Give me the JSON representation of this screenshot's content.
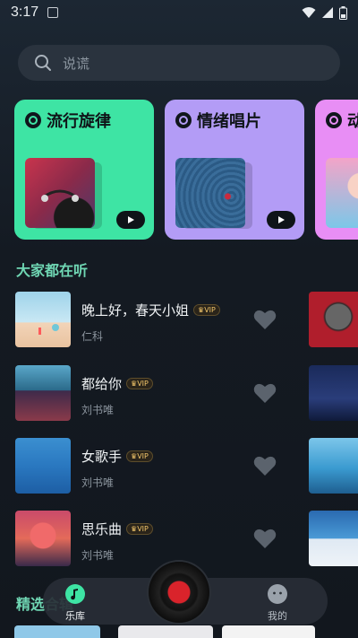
{
  "status_bar": {
    "time": "3:17"
  },
  "search": {
    "placeholder": "说谎"
  },
  "categories": [
    {
      "label": "流行旋律",
      "bg": "#3ee4a4"
    },
    {
      "label": "情绪唱片",
      "bg": "#b39cf6"
    },
    {
      "label": "动",
      "bg": "#e88ef5"
    }
  ],
  "section_popular": "大家都在听",
  "songs": [
    {
      "title": "晚上好，春天小姐",
      "artist": "仁科",
      "vip": "VIP"
    },
    {
      "title": "都给你",
      "artist": "刘书唯",
      "vip": "VIP"
    },
    {
      "title": "女歌手",
      "artist": "刘书唯",
      "vip": "VIP"
    },
    {
      "title": "思乐曲",
      "artist": "刘书唯",
      "vip": "VIP"
    }
  ],
  "section_featured": "精选合辑",
  "nav": {
    "library_label": "乐库",
    "mine_label": "我的"
  },
  "colors": {
    "accent": "#6fd6b3",
    "library_active": "#3ee4a4"
  }
}
